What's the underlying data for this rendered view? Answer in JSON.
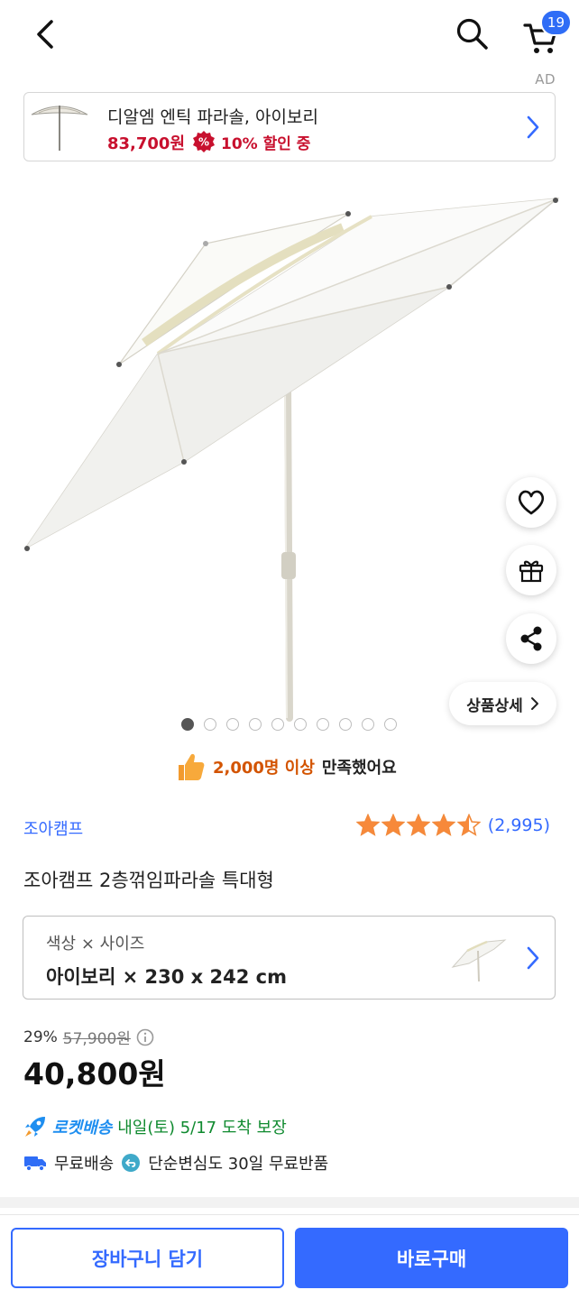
{
  "header": {
    "back_icon": "chevron-left-icon",
    "search_icon": "search-icon",
    "cart_icon": "cart-icon",
    "cart_count": "19"
  },
  "ad": {
    "label": "AD",
    "title": "디알엠 엔틱 파라솔, 아이보리",
    "price": "83,700원",
    "discount": "10% 할인 중"
  },
  "gallery": {
    "total_images": 10,
    "active_index": 0
  },
  "actions": {
    "wishlist_icon": "heart-icon",
    "gift_icon": "gift-icon",
    "share_icon": "share-icon",
    "detail_label": "상품상세"
  },
  "satisfaction": {
    "highlight": "2,000명 이상",
    "text": "만족했어요"
  },
  "product": {
    "brand": "조아캠프",
    "rating": 4.5,
    "review_count": "(2,995)",
    "title": "조아캠프 2층꺾임파라솔 특대형"
  },
  "option": {
    "label": "색상 × 사이즈",
    "value": "아이보리 × 230 x 242 cm"
  },
  "price": {
    "discount_rate": "29%",
    "original": "57,900원",
    "final": "40,800원"
  },
  "delivery": {
    "rocket_label": "로켓배송",
    "eta": "내일(토) 5/17 도착 보장",
    "free_shipping": "무료배송",
    "return_policy": "단순변심도 30일 무료반품"
  },
  "colors": {
    "accent": "#346aff",
    "sale_red": "#c8102e",
    "satisfaction_orange": "#d35400",
    "rocket_green": "#0f8a2f"
  },
  "bottom": {
    "add_to_cart": "장바구니 담기",
    "buy_now": "바로구매"
  }
}
